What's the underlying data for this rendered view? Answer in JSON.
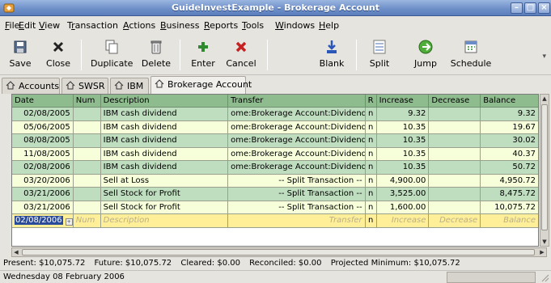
{
  "window": {
    "title": "GuideInvestExample - Brokerage Account"
  },
  "menu": [
    {
      "label": "File",
      "ul": "F"
    },
    {
      "label": "Edit",
      "ul": "E"
    },
    {
      "label": "View",
      "ul": "V"
    },
    {
      "label": "Transaction",
      "ul": "r"
    },
    {
      "label": "Actions",
      "ul": "A"
    },
    {
      "label": "Business",
      "ul": "B"
    },
    {
      "label": "Reports",
      "ul": "R"
    },
    {
      "label": "Tools",
      "ul": "T"
    },
    {
      "label": "Windows",
      "ul": "W"
    },
    {
      "label": "Help",
      "ul": "H"
    }
  ],
  "toolbar": {
    "save": "Save",
    "close": "Close",
    "duplicate": "Duplicate",
    "delete": "Delete",
    "enter": "Enter",
    "cancel": "Cancel",
    "blank": "Blank",
    "split": "Split",
    "jump": "Jump",
    "schedule": "Schedule"
  },
  "tabs": [
    "Accounts",
    "SWSR",
    "IBM",
    "Brokerage Account"
  ],
  "active_tab": "Brokerage Account",
  "register": {
    "columns": {
      "date": "Date",
      "num": "Num",
      "description": "Description",
      "transfer": "Transfer",
      "r": "R",
      "increase": "Increase",
      "decrease": "Decrease",
      "balance": "Balance"
    },
    "rows": [
      {
        "date": "02/08/2005",
        "num": "",
        "description": "IBM cash dividend",
        "transfer": "ome:Brokerage Account:Dividends",
        "r": "n",
        "increase": "9.32",
        "decrease": "",
        "balance": "9.32"
      },
      {
        "date": "05/06/2005",
        "num": "",
        "description": "IBM cash dividend",
        "transfer": "ome:Brokerage Account:Dividends",
        "r": "n",
        "increase": "10.35",
        "decrease": "",
        "balance": "19.67"
      },
      {
        "date": "08/08/2005",
        "num": "",
        "description": "IBM cash dividend",
        "transfer": "ome:Brokerage Account:Dividends",
        "r": "n",
        "increase": "10.35",
        "decrease": "",
        "balance": "30.02"
      },
      {
        "date": "11/08/2005",
        "num": "",
        "description": "IBM cash dividend",
        "transfer": "ome:Brokerage Account:Dividends",
        "r": "n",
        "increase": "10.35",
        "decrease": "",
        "balance": "40.37"
      },
      {
        "date": "02/08/2006",
        "num": "",
        "description": "IBM cash dividend",
        "transfer": "ome:Brokerage Account:Dividends",
        "r": "n",
        "increase": "10.35",
        "decrease": "",
        "balance": "50.72"
      },
      {
        "date": "03/20/2006",
        "num": "",
        "description": "Sell at Loss",
        "transfer": "-- Split Transaction --",
        "r": "n",
        "increase": "4,900.00",
        "decrease": "",
        "balance": "4,950.72"
      },
      {
        "date": "03/21/2006",
        "num": "",
        "description": "Sell Stock for Profit",
        "transfer": "-- Split Transaction --",
        "r": "n",
        "increase": "3,525.00",
        "decrease": "",
        "balance": "8,475.72"
      },
      {
        "date": "03/21/2006",
        "num": "",
        "description": "Sell Stock for Profit",
        "transfer": "-- Split Transaction --",
        "r": "n",
        "increase": "1,600.00",
        "decrease": "",
        "balance": "10,075.72"
      }
    ],
    "blank_row": {
      "date": "02/08/2006",
      "num": "Num",
      "description": "Description",
      "transfer": "Transfer",
      "r": "n",
      "increase": "Increase",
      "decrease": "Decrease",
      "balance": "Balance"
    }
  },
  "summary": {
    "present": "Present: $10,075.72",
    "future": "Future: $10,075.72",
    "cleared": "Cleared: $0.00",
    "reconciled": "Reconciled: $0.00",
    "projected": "Projected Minimum: $10,075.72"
  },
  "status": {
    "message": "Wednesday 08 February 2006"
  },
  "colors": {
    "header": "#8fbc8f",
    "row_a": "#bfdebf",
    "row_b": "#f6ffda",
    "blank_row": "#ffef98",
    "titlebar": "#6f90c9"
  }
}
